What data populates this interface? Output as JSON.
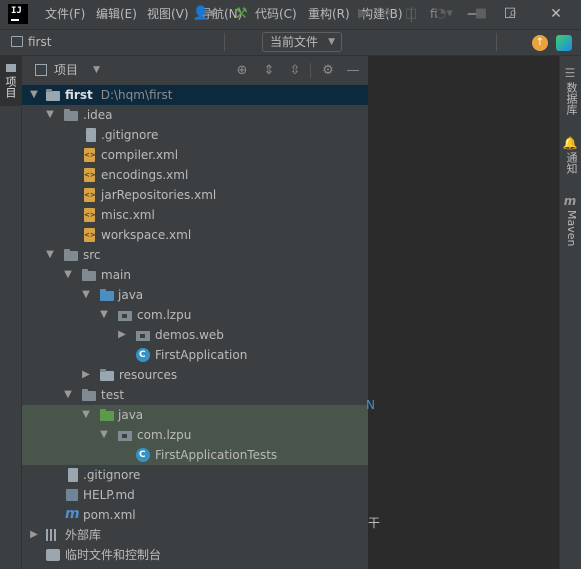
{
  "menu": [
    "文件(F)",
    "编辑(E)",
    "视图(V)",
    "导航(N)",
    "代码(C)",
    "重构(R)",
    "构建(B)",
    "fi"
  ],
  "app_logo": "IJ",
  "window_controls": [
    "—",
    "☐",
    "✕"
  ],
  "toolbar": {
    "project_name": "first",
    "run_config": "当前文件"
  },
  "left_stripe": {
    "project_tab": "项目"
  },
  "panel": {
    "title": "项目"
  },
  "tree": [
    {
      "label": "first",
      "hint": "D:\\hqm\\first"
    },
    {
      "label": ".idea"
    },
    {
      "label": ".gitignore"
    },
    {
      "label": "compiler.xml"
    },
    {
      "label": "encodings.xml"
    },
    {
      "label": "jarRepositories.xml"
    },
    {
      "label": "misc.xml"
    },
    {
      "label": "workspace.xml"
    },
    {
      "label": "src"
    },
    {
      "label": "main"
    },
    {
      "label": "java"
    },
    {
      "label": "com.lzpu"
    },
    {
      "label": "demos.web"
    },
    {
      "label": "FirstApplication"
    },
    {
      "label": "resources"
    },
    {
      "label": "test"
    },
    {
      "label": "java"
    },
    {
      "label": "com.lzpu"
    },
    {
      "label": "FirstApplicationTests"
    },
    {
      "label": ".gitignore"
    },
    {
      "label": "HELP.md"
    },
    {
      "label": "pom.xml"
    },
    {
      "label": "外部库"
    },
    {
      "label": "临时文件和控制台"
    }
  ],
  "editor": {
    "fragment_1": "N",
    "fragment_2": "干"
  },
  "right_stripe": {
    "database": "数据库",
    "notifications": "通知",
    "maven": "Maven"
  }
}
